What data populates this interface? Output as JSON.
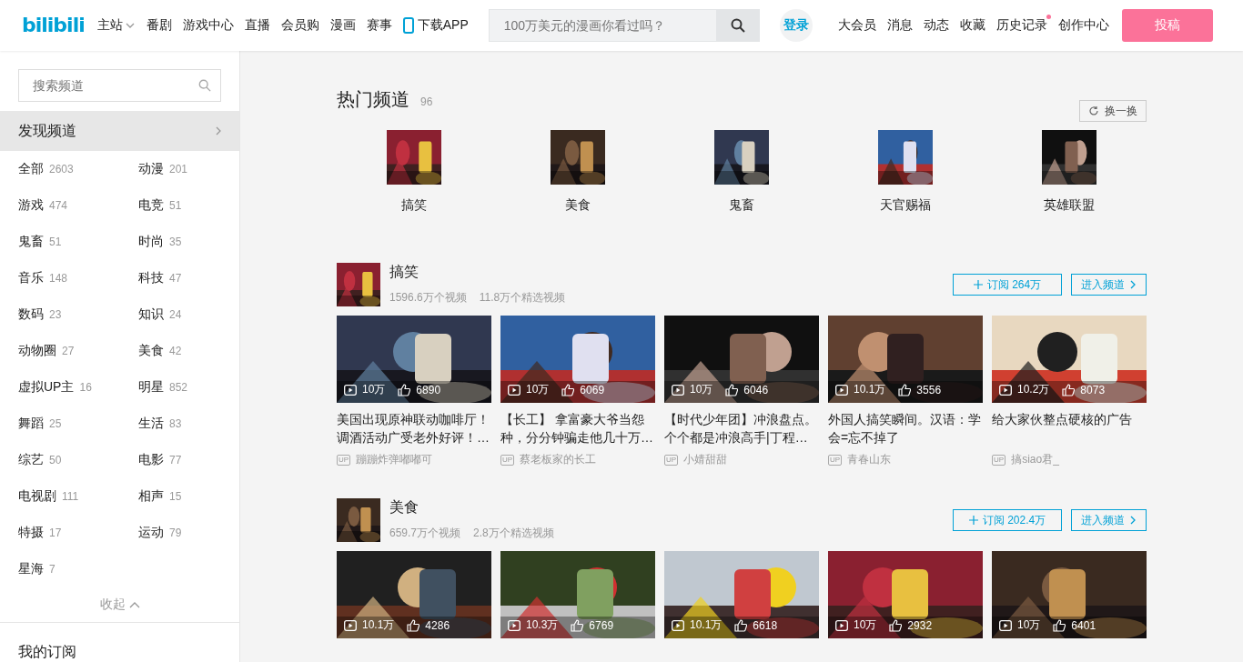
{
  "header": {
    "logo": "bilibili",
    "nav": [
      {
        "label": "主站",
        "dropdown": true
      },
      {
        "label": "番剧",
        "dropdown": false
      },
      {
        "label": "游戏中心",
        "dropdown": false
      },
      {
        "label": "直播",
        "dropdown": false
      },
      {
        "label": "会员购",
        "dropdown": false
      },
      {
        "label": "漫画",
        "dropdown": false
      },
      {
        "label": "赛事",
        "dropdown": false
      }
    ],
    "download": "下载APP",
    "search": {
      "placeholder": "100万美元的漫画你看过吗？"
    },
    "login": "登录",
    "right_nav": [
      {
        "label": "大会员",
        "dot": false
      },
      {
        "label": "消息",
        "dot": false
      },
      {
        "label": "动态",
        "dot": false
      },
      {
        "label": "收藏",
        "dot": false
      },
      {
        "label": "历史记录",
        "dot": true
      },
      {
        "label": "创作中心",
        "dot": false
      }
    ],
    "upload": "投稿"
  },
  "sidebar": {
    "search": {
      "placeholder": "搜索频道"
    },
    "discover": "发现频道",
    "categories": [
      {
        "name": "全部",
        "count": "2603"
      },
      {
        "name": "动漫",
        "count": "201"
      },
      {
        "name": "游戏",
        "count": "474"
      },
      {
        "name": "电竞",
        "count": "51"
      },
      {
        "name": "鬼畜",
        "count": "51"
      },
      {
        "name": "时尚",
        "count": "35"
      },
      {
        "name": "音乐",
        "count": "148"
      },
      {
        "name": "科技",
        "count": "47"
      },
      {
        "name": "数码",
        "count": "23"
      },
      {
        "name": "知识",
        "count": "24"
      },
      {
        "name": "动物圈",
        "count": "27"
      },
      {
        "name": "美食",
        "count": "42"
      },
      {
        "name": "虚拟UP主",
        "count": "16"
      },
      {
        "name": "明星",
        "count": "852"
      },
      {
        "name": "舞蹈",
        "count": "25"
      },
      {
        "name": "生活",
        "count": "83"
      },
      {
        "name": "综艺",
        "count": "50"
      },
      {
        "name": "电影",
        "count": "77"
      },
      {
        "name": "电视剧",
        "count": "111"
      },
      {
        "name": "相声",
        "count": "15"
      },
      {
        "name": "特摄",
        "count": "17"
      },
      {
        "name": "运动",
        "count": "79"
      },
      {
        "name": "星海",
        "count": "7"
      }
    ],
    "collapse": "收起",
    "subscriptions": "我的订阅"
  },
  "hot": {
    "title": "热门频道",
    "count": "96",
    "refresh": "换一换",
    "channels": [
      {
        "name": "搞笑"
      },
      {
        "name": "美食"
      },
      {
        "name": "鬼畜"
      },
      {
        "name": "天官赐福"
      },
      {
        "name": "英雄联盟"
      }
    ]
  },
  "sections": [
    {
      "name": "搞笑",
      "videos_count": "1596.6万个视频",
      "featured_count": "11.8万个精选视频",
      "subscribe": "订阅 264万",
      "enter": "进入频道",
      "videos": [
        {
          "plays": "10万",
          "likes": "6890",
          "title": "美国出现原神联动咖啡厅！调酒活动广受老外好评！…",
          "badge": "UP",
          "uploader": "蹦蹦炸弹嘟嘟可"
        },
        {
          "plays": "10万",
          "likes": "6069",
          "title": "【长工】 拿富豪大爷当怨种，分分钟骗走他几十万…",
          "badge": "UP",
          "uploader": "蔡老板家的长工"
        },
        {
          "plays": "10万",
          "likes": "6046",
          "title": "【时代少年团】冲浪盘点。个个都是冲浪高手|丁程…",
          "badge": "UP",
          "uploader": "小婧甜甜"
        },
        {
          "plays": "10.1万",
          "likes": "3556",
          "title": "外国人搞笑瞬间。汉语：学会=忘不掉了",
          "badge": "UP",
          "uploader": "青春山东"
        },
        {
          "plays": "10.2万",
          "likes": "8073",
          "title": "给大家伙整点硬核的广告",
          "badge": "UP",
          "uploader": "搞siao君_"
        }
      ]
    },
    {
      "name": "美食",
      "videos_count": "659.7万个视频",
      "featured_count": "2.8万个精选视频",
      "subscribe": "订阅 202.4万",
      "enter": "进入频道",
      "videos": [
        {
          "plays": "10.1万",
          "likes": "4286"
        },
        {
          "plays": "10.3万",
          "likes": "6769"
        },
        {
          "plays": "10.1万",
          "likes": "6618"
        },
        {
          "plays": "10万",
          "likes": "2932"
        },
        {
          "plays": "10万",
          "likes": "6401"
        }
      ]
    }
  ]
}
